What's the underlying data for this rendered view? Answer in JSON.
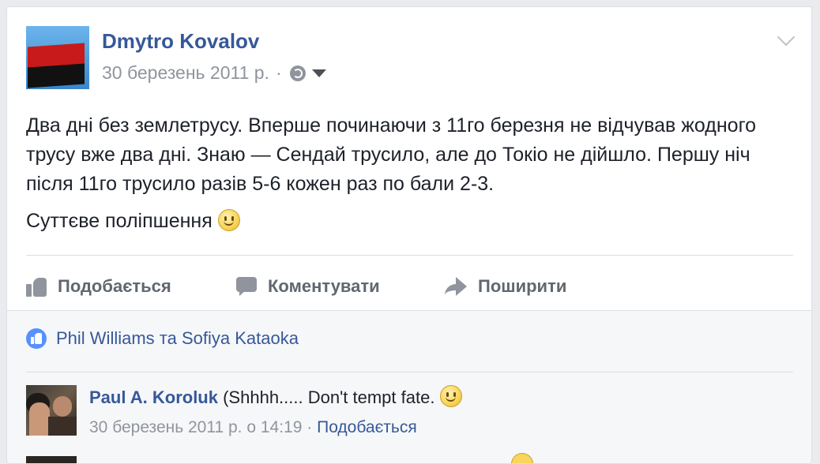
{
  "post": {
    "author": "Dmytro Kovalov",
    "date": "30 березень 2011 р.",
    "separator": "·",
    "body_paragraph_1": "Два дні без землетрусу. Вперше починаючи з 11го березня не відчував жодного трусу вже два дні. Знаю — Сендай трусило, але до Токіо не дійшло. Першу ніч після 11го трусило разів 5-6 кожен раз по бали 2-3.",
    "body_paragraph_2": "Суттєве поліпшення"
  },
  "actions": {
    "like_label": "Подобається",
    "comment_label": "Коментувати",
    "share_label": "Поширити"
  },
  "likes": {
    "text": "Phil Williams та Sofiya Kataoka"
  },
  "comment": {
    "author": "Paul A. Koroluk",
    "text": "(Shhhh..... Don't tempt fate.",
    "date": "30 березень 2011 р. о 14:19",
    "separator": "·",
    "like_label": "Подобається"
  },
  "colors": {
    "link": "#365899",
    "muted": "#90949c",
    "like_badge": "#5890ff"
  },
  "icons": [
    "globe-icon",
    "caret-down-icon",
    "chevron-down-icon",
    "smiley-icon",
    "like-icon",
    "comment-icon",
    "share-icon",
    "like-badge-icon"
  ]
}
